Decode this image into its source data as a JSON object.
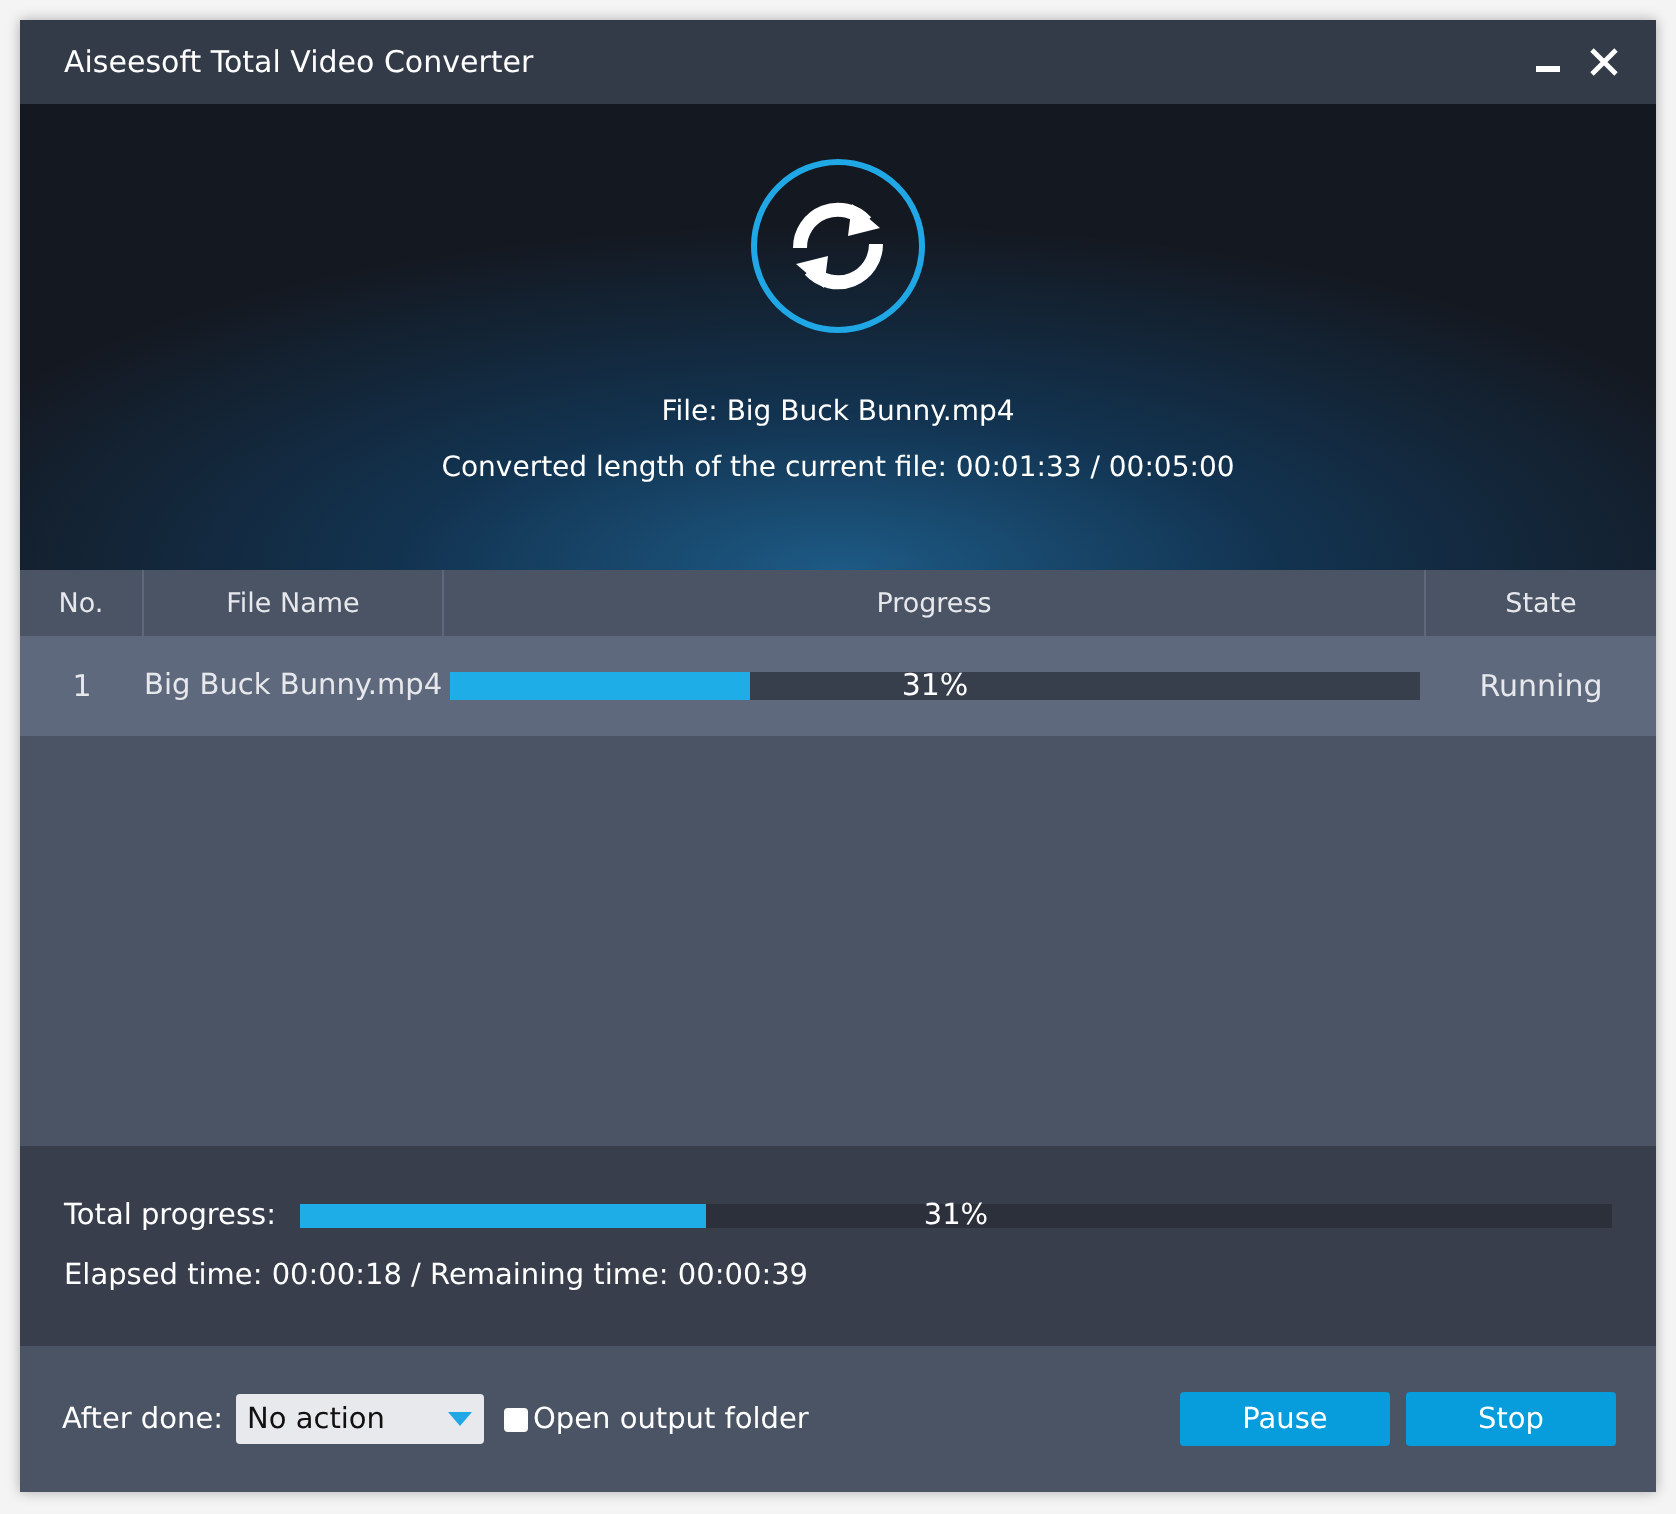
{
  "window": {
    "title": "Aiseesoft Total Video Converter"
  },
  "banner": {
    "file": "File: Big Buck Bunny.mp4",
    "converted": "Converted length of the current file: 00:01:33 / 00:05:00"
  },
  "table": {
    "columns": [
      "No.",
      "File Name",
      "Progress",
      "State"
    ],
    "rows": [
      {
        "no": "1",
        "file_name": "Big Buck Bunny.mp4",
        "level": 0.31,
        "percent": "31%",
        "state": "Running"
      }
    ]
  },
  "total": {
    "label": "Total progress:",
    "level": 0.31,
    "percent": "31%",
    "times": "Elapsed time: 00:00:18 / Remaining time: 00:00:39"
  },
  "footer": {
    "after_done_label": "After done:",
    "after_done_value": "No action",
    "open_folder": {
      "label": "Open output folder",
      "checked": false
    },
    "buttons": [
      "Pause",
      "Stop"
    ]
  }
}
